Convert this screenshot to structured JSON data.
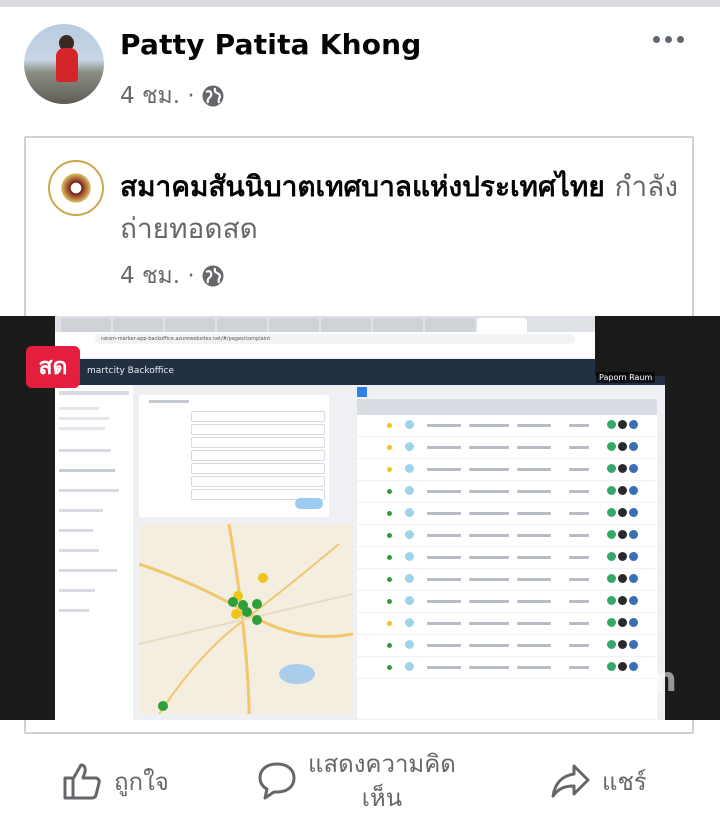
{
  "post": {
    "author": "Patty Patita Khong",
    "time": "4 ชม. ·",
    "privacy_icon": "globe-icon",
    "more_icon": "more-dots-icon"
  },
  "shared": {
    "page_name": "สมาคมสันนิบาตเทศบาลแห่งประเทศไทย",
    "live_status": "กำลังถ่ายทอดสด",
    "time": "4 ชม. ·",
    "privacy_icon": "globe-icon"
  },
  "video": {
    "live_badge": "สด",
    "app_title": "martcity Backoffice",
    "url": "ratom-marker-app-backoffice.azurewebsites.net/#/pages/complaint",
    "participant_name": "Paporn Raum",
    "watermark": "zoom"
  },
  "actions": {
    "like": "ถูกใจ",
    "comment_line1": "แสดงความคิด",
    "comment_line2": "เห็น",
    "share": "แชร์"
  },
  "colors": {
    "live_red": "#e41e3f",
    "secondary_text": "#65676b",
    "app_header": "#233044"
  }
}
